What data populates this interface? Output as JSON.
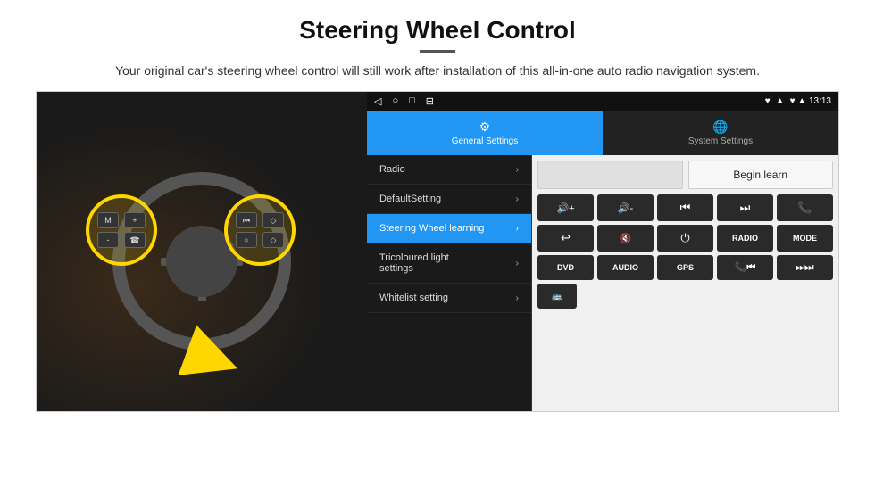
{
  "header": {
    "title": "Steering Wheel Control",
    "subtitle": "Your original car's steering wheel control will still work after installation of this all-in-one auto radio navigation system."
  },
  "status_bar": {
    "nav_icons": [
      "◁",
      "○",
      "□",
      "⊟"
    ],
    "right": "♥ ▲ 13:13"
  },
  "tabs": [
    {
      "label": "General Settings",
      "active": true
    },
    {
      "label": "System Settings",
      "active": false
    }
  ],
  "menu_items": [
    {
      "label": "Radio",
      "active": false
    },
    {
      "label": "DefaultSetting",
      "active": false
    },
    {
      "label": "Steering Wheel learning",
      "active": true
    },
    {
      "label": "Tricoloured light settings",
      "active": false
    },
    {
      "label": "Whitelist setting",
      "active": false
    }
  ],
  "begin_learn_label": "Begin learn",
  "ctrl_row1": [
    {
      "icon": "🔊+",
      "label": ""
    },
    {
      "icon": "🔊-",
      "label": ""
    },
    {
      "icon": "⏮",
      "label": ""
    },
    {
      "icon": "⏭",
      "label": ""
    },
    {
      "icon": "📞",
      "label": ""
    }
  ],
  "ctrl_row2": [
    {
      "icon": "↩",
      "label": ""
    },
    {
      "icon": "🔇",
      "label": ""
    },
    {
      "icon": "⏻",
      "label": ""
    },
    {
      "icon": "RADIO",
      "label": "RADIO"
    },
    {
      "icon": "MODE",
      "label": "MODE"
    }
  ],
  "ctrl_row3": [
    {
      "icon": "DVD",
      "label": "DVD"
    },
    {
      "icon": "AUDIO",
      "label": "AUDIO"
    },
    {
      "icon": "GPS",
      "label": "GPS"
    },
    {
      "icon": "📞⏮",
      "label": ""
    },
    {
      "icon": "⏭⏭",
      "label": ""
    }
  ],
  "bus_icon": "🚌"
}
